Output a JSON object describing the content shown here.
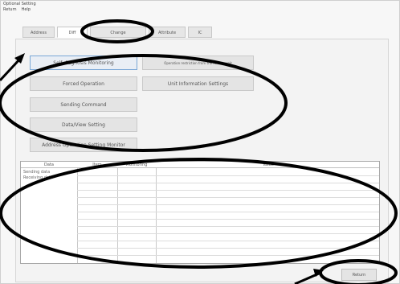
{
  "window": {
    "title": "Optional Setting"
  },
  "menu": [
    "Return",
    "Help"
  ],
  "tabs": [
    {
      "label": "Address"
    },
    {
      "label": "Diff"
    },
    {
      "label": "Change"
    },
    {
      "label": "Attribute"
    },
    {
      "label": "IC"
    }
  ],
  "buttons": {
    "diagnosis": "Self-diagnosis Monitoring",
    "restriction": "Operation restriction from the remote unit",
    "forced": "Forced Operation",
    "unit_info": "Unit Information Settings",
    "sending": "Sending Command",
    "data_view": "Data/View Setting",
    "address_monitor": "Address Operation Setting Monitor"
  },
  "table": {
    "headers": [
      "Data",
      "Item",
      "Monitoring",
      "Value"
    ],
    "row_labels": [
      "Sending data",
      "Receiving data"
    ]
  },
  "footer": {
    "return_label": "Return"
  },
  "annotation": {
    "color": "#000000"
  }
}
